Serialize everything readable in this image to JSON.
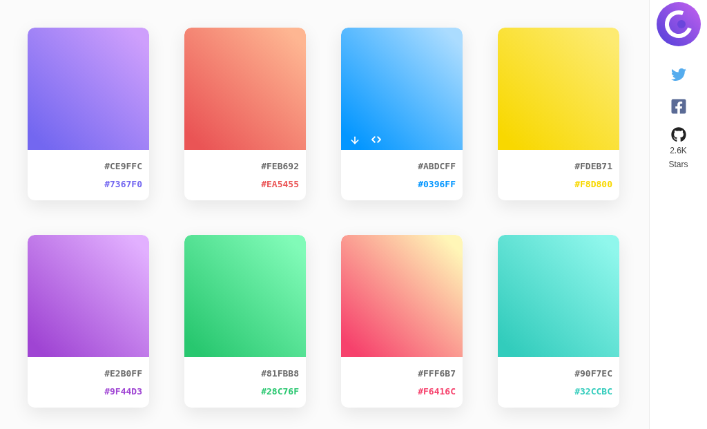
{
  "cards": [
    {
      "start": {
        "code": "#CE9FFC",
        "color": "#ce9ffc"
      },
      "end": {
        "code": "#7367F0",
        "color": "#7367f0"
      },
      "hovered": false
    },
    {
      "start": {
        "code": "#FEB692",
        "color": "#feb692"
      },
      "end": {
        "code": "#EA5455",
        "color": "#ea5455"
      },
      "hovered": false
    },
    {
      "start": {
        "code": "#ABDCFF",
        "color": "#abdcff"
      },
      "end": {
        "code": "#0396FF",
        "color": "#0396ff"
      },
      "hovered": true
    },
    {
      "start": {
        "code": "#FDEB71",
        "color": "#fdeb71"
      },
      "end": {
        "code": "#F8D800",
        "color": "#f8d800"
      },
      "hovered": false
    },
    {
      "start": {
        "code": "#E2B0FF",
        "color": "#e2b0ff"
      },
      "end": {
        "code": "#9F44D3",
        "color": "#9f44d3"
      },
      "hovered": false
    },
    {
      "start": {
        "code": "#81FBB8",
        "color": "#81fbb8"
      },
      "end": {
        "code": "#28C76F",
        "color": "#28c76f"
      },
      "hovered": false
    },
    {
      "start": {
        "code": "#FFF6B7",
        "color": "#fff6b7"
      },
      "end": {
        "code": "#F6416C",
        "color": "#f6416c"
      },
      "hovered": false
    },
    {
      "start": {
        "code": "#90F7EC",
        "color": "#90f7ec"
      },
      "end": {
        "code": "#32CCBC",
        "color": "#32ccbc"
      },
      "hovered": false
    }
  ],
  "sidebar": {
    "github_stars": "2.6K Stars"
  }
}
